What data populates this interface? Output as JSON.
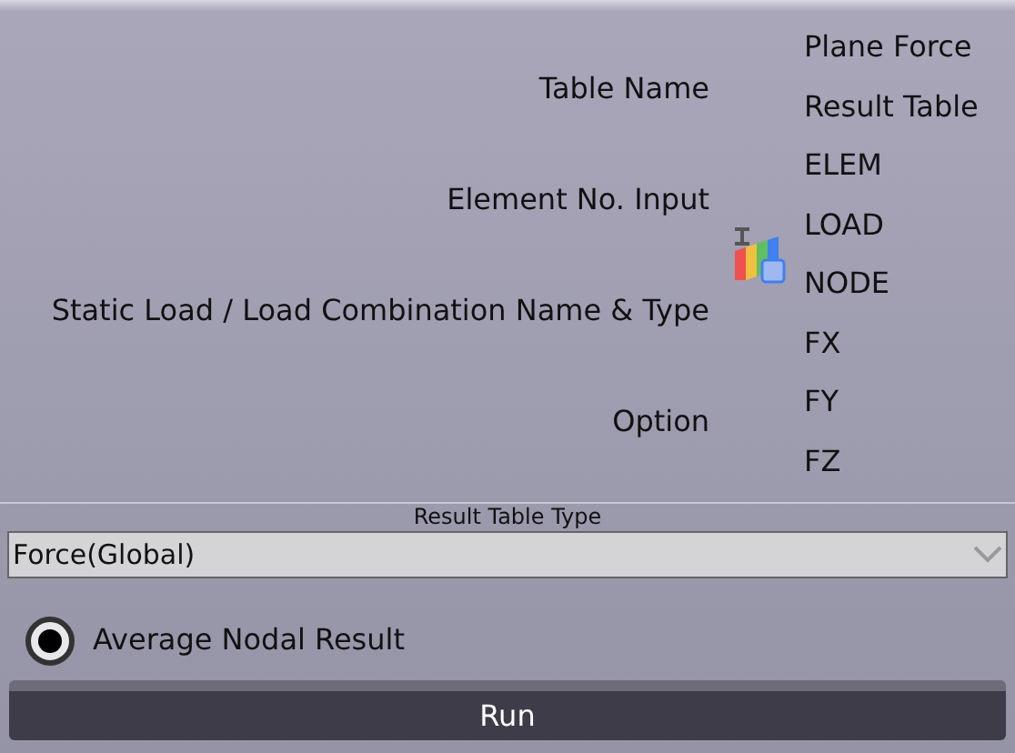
{
  "labels": [
    "Table Name",
    "Element No. Input",
    "Static Load / Load Combination Name & Type",
    "Option"
  ],
  "values": [
    "Plane Force",
    "Result Table",
    "ELEM",
    "LOAD",
    "NODE",
    "FX",
    "FY",
    "FZ"
  ],
  "result_table_type": {
    "label": "Result Table Type",
    "value": "Force(Global)"
  },
  "options": [
    {
      "label": "Average Nodal Result",
      "selected": true
    }
  ],
  "buttons": [
    "Run"
  ]
}
